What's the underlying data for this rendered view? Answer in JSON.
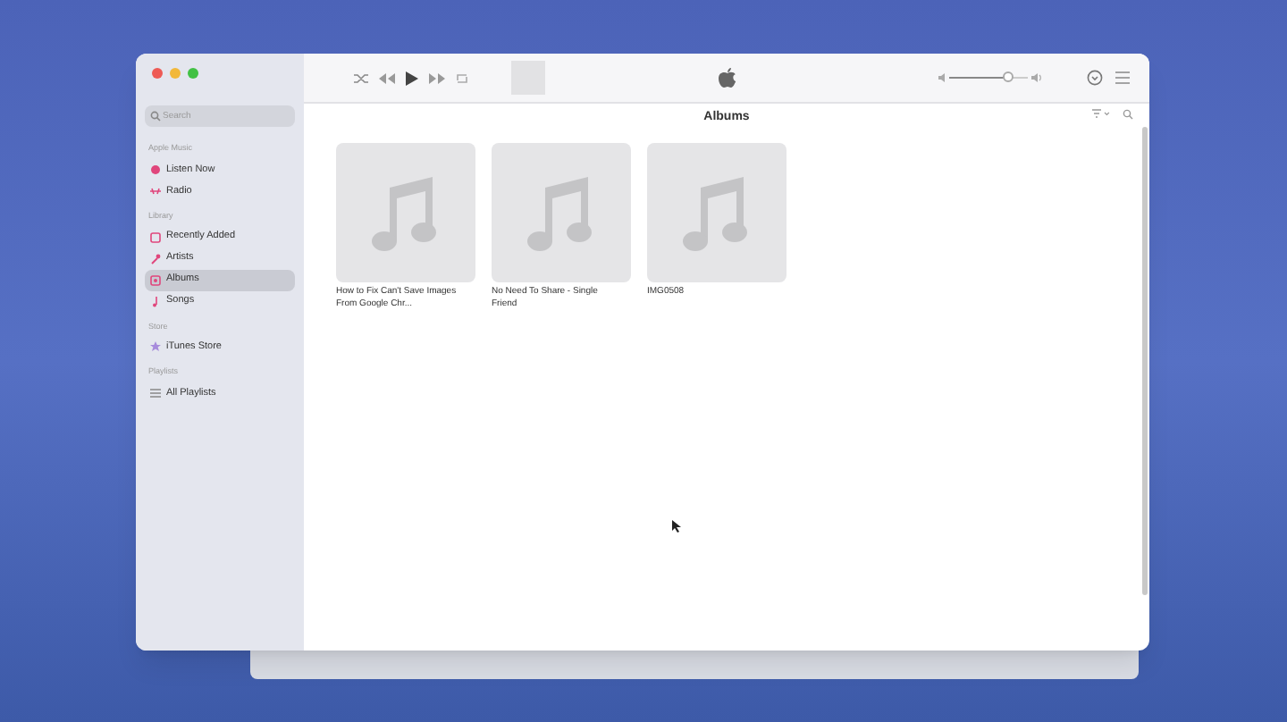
{
  "sidebar": {
    "search": {
      "placeholder": "Search"
    },
    "sections": [
      {
        "heading": "Apple Music",
        "items": [
          {
            "label": "Listen Now",
            "kind": "play",
            "selected": false
          },
          {
            "label": "Radio",
            "kind": "radio",
            "selected": false
          }
        ]
      },
      {
        "heading": "Library",
        "items": [
          {
            "label": "Recently Added",
            "kind": "clock",
            "selected": false
          },
          {
            "label": "Artists",
            "kind": "mic",
            "selected": false
          },
          {
            "label": "Albums",
            "kind": "album",
            "selected": true
          },
          {
            "label": "Songs",
            "kind": "note",
            "selected": false
          }
        ]
      },
      {
        "heading": "Store",
        "items": [
          {
            "label": "iTunes Store",
            "kind": "star",
            "selected": false
          }
        ]
      },
      {
        "heading": "Playlists",
        "items": [
          {
            "label": "All Playlists",
            "kind": "grid",
            "selected": false
          }
        ]
      }
    ]
  },
  "toolbar": {
    "volume": {
      "level": 0.75
    }
  },
  "content": {
    "title": "Albums",
    "albums": [
      {
        "title": "How to Fix Can't Save Images From Google Chr..."
      },
      {
        "title": "No Need To Share - Single Friend"
      },
      {
        "title": "IMG0508"
      }
    ]
  }
}
